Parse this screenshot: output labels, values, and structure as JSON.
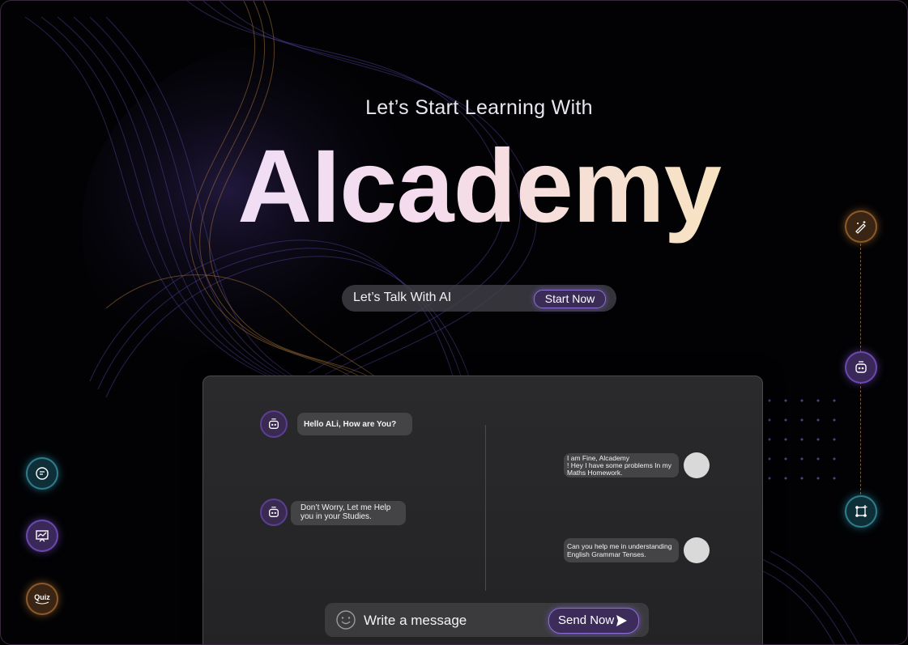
{
  "hero": {
    "subtitle": "Let’s Start Learning With",
    "title": "AIcademy"
  },
  "cta": {
    "text": "Let’s Talk With AI",
    "button_label": "Start Now"
  },
  "left_rail": {
    "icons": [
      "chat-bubble-icon",
      "presentation-icon",
      "quiz-icon"
    ],
    "quiz_label": "Quiz"
  },
  "right_rail": {
    "icons": [
      "magic-pencil-icon",
      "robot-icon",
      "shapes-icon"
    ]
  },
  "chat": {
    "messages": [
      {
        "from": "bot",
        "text": "Hello ALi, How are You?"
      },
      {
        "from": "user",
        "text_lines": [
          "I am Fine, Alcademy",
          "! Hey I have some problems In my",
          "Maths Homework."
        ]
      },
      {
        "from": "bot",
        "text_lines": [
          "Don’t Worry, Let me Help",
          "you in your Studies."
        ]
      },
      {
        "from": "user",
        "text_lines": [
          "Can you help me in understanding",
          "English Grammar Tenses."
        ]
      }
    ],
    "input_placeholder": "Write a message",
    "send_label": "Send Now"
  },
  "colors": {
    "accent_purple": "#8b6fd0",
    "accent_orange": "#e0953c",
    "accent_teal": "#3cc8e6"
  }
}
